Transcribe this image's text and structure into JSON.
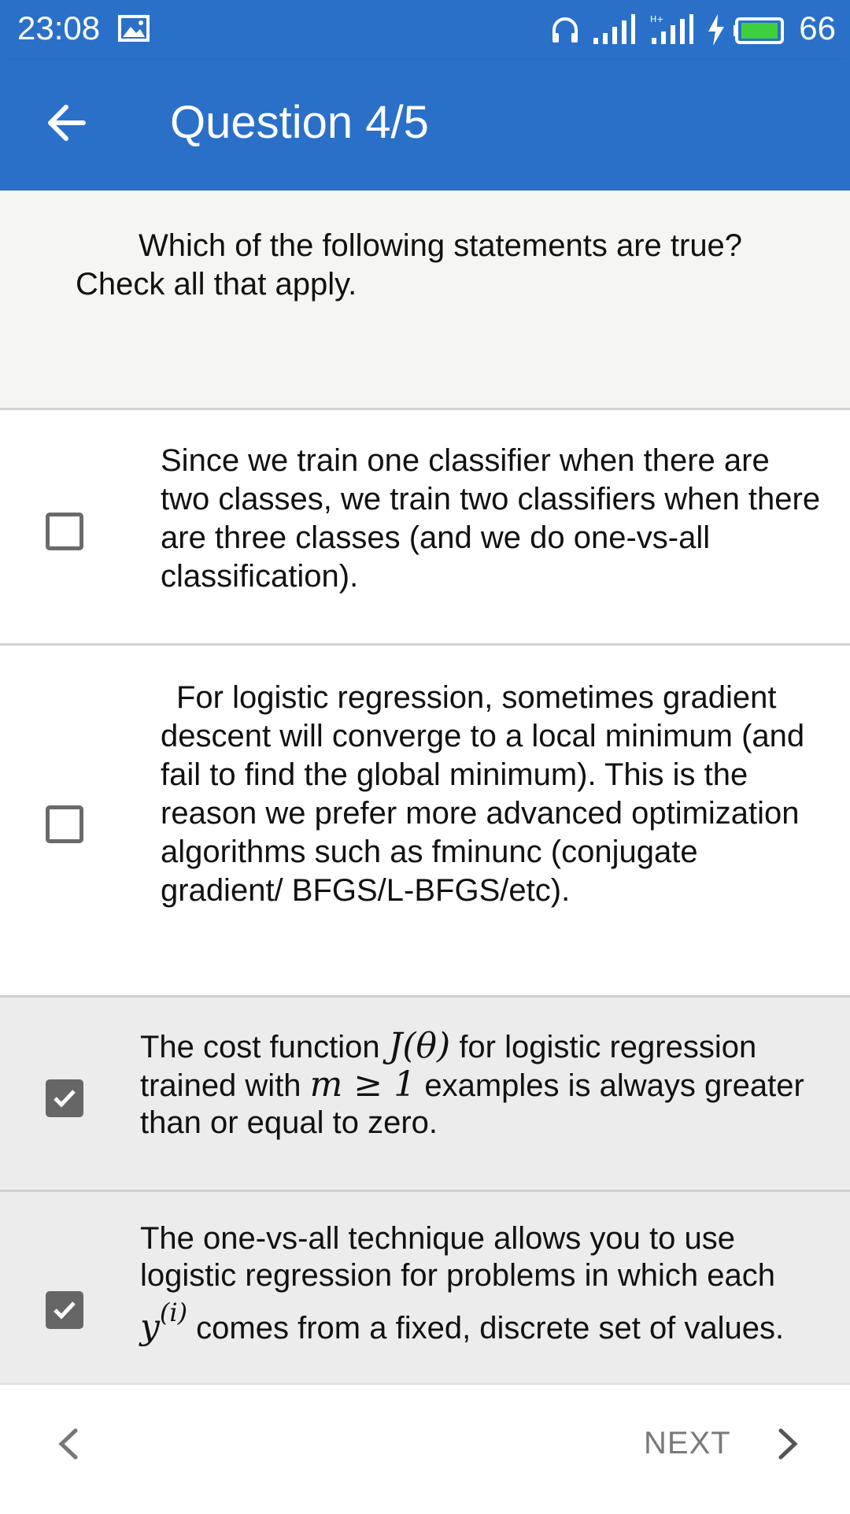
{
  "status_bar": {
    "time": "23:08",
    "battery_level": "66",
    "icons": [
      "image-icon",
      "headset-icon",
      "signal-icon",
      "hplus-signal-icon",
      "charging-icon",
      "battery-icon"
    ]
  },
  "app_bar": {
    "title": "Question 4/5",
    "back_icon": "arrow-left-icon",
    "color": "#2a70c9"
  },
  "question": {
    "text": "Which of the following statements are true? Check all that apply."
  },
  "options": [
    {
      "text": "Since we train one classifier when there are two classes, we train two classifiers when there are three classes (and we do one-vs-all classification).",
      "checked": false
    },
    {
      "text": "For logistic regression, sometimes gradient descent will converge to a local minimum (and fail to find the global minimum).  This is the reason we prefer more advanced optimization algorithms such as fminunc (conjugate gradient/ BFGS/L-BFGS/etc).",
      "checked": false
    },
    {
      "text_parts": [
        "The cost function ",
        "J(θ)",
        " for logistic regression trained with ",
        "m ≥ 1",
        " examples is always greater than or equal to zero."
      ],
      "checked": true
    },
    {
      "text_parts": [
        "The one-vs-all technique allows you to use logistic regression for problems in which each ",
        "y",
        "(i)",
        " comes from a fixed, discrete set of values."
      ],
      "checked": true
    }
  ],
  "navigation": {
    "next_label": "NEXT",
    "prev_icon": "chevron-left-icon",
    "next_icon": "chevron-right-icon"
  }
}
